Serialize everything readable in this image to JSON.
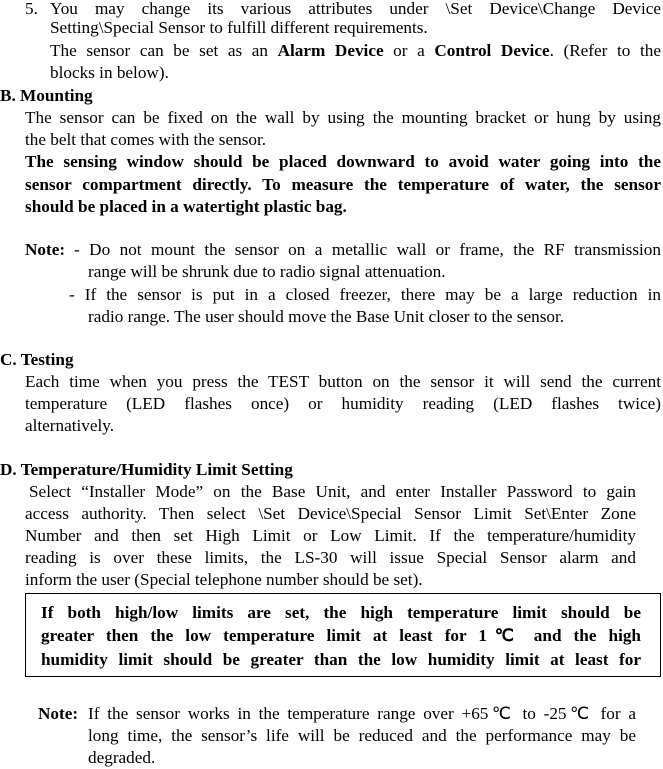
{
  "item5": {
    "number": "5.",
    "line1": "You may change its various attributes under \\Set Device\\Change Device",
    "line2": "Setting\\Special Sensor to fulfill different requirements.",
    "line3_pre": "The sensor can be set as an ",
    "line3_b1": "Alarm Device",
    "line3_mid": " or a ",
    "line3_b2": "Control Device",
    "line3_post": ". (Refer to the",
    "line4": "blocks in below)."
  },
  "mounting": {
    "heading": "B. Mounting",
    "p1_l1": "The sensor can be fixed on the wall by using the mounting bracket or hung by using",
    "p1_l2": "the belt that comes with the sensor.",
    "p2_l1": "The sensing window should be placed downward to avoid water going into the",
    "p2_l2": "sensor compartment directly. To measure the temperature of water, the sensor",
    "p2_l3": "should be placed in a watertight plastic bag.",
    "note_label": "Note:",
    "note1_l1": "- Do not mount the sensor on a metallic wall or frame, the RF transmission",
    "note1_l2": "range will be shrunk due to radio signal attenuation.",
    "note2_l1": "- If the sensor is put in a closed freezer, there may be a large reduction in",
    "note2_l2": "radio range. The user should move the Base Unit closer to the sensor."
  },
  "testing": {
    "heading": "C. Testing",
    "l1": "Each time when you press the TEST button on the sensor it will send the current",
    "l2": "temperature (LED flashes once) or humidity reading (LED flashes twice)",
    "l3": "alternatively."
  },
  "limit": {
    "heading": "D. Temperature/Humidity Limit Setting",
    "l1": "Select “Installer Mode” on the Base Unit, and enter Installer Password to gain",
    "l2": "access authority. Then select \\Set Device\\Special Sensor Limit Set\\Enter Zone",
    "l3": "Number and then set High Limit or Low Limit. If the temperature/humidity",
    "l4": "reading is over these limits, the LS-30 will issue Special Sensor alarm and",
    "l5": "inform the user (Special telephone number should be set).",
    "box_l1": "If both high/low limits are set, the high temperature limit should be",
    "box_l2": "greater then the low temperature limit at least for 1℃ and the high",
    "box_l3": "humidity limit should be greater than the low humidity limit at least for",
    "note_label": "Note:",
    "note_l1": "If the sensor works in the temperature range over +65℃  to -25℃  for a",
    "note_l2": "long time, the sensor’s life will be reduced and the performance may be",
    "note_l3": "degraded."
  }
}
